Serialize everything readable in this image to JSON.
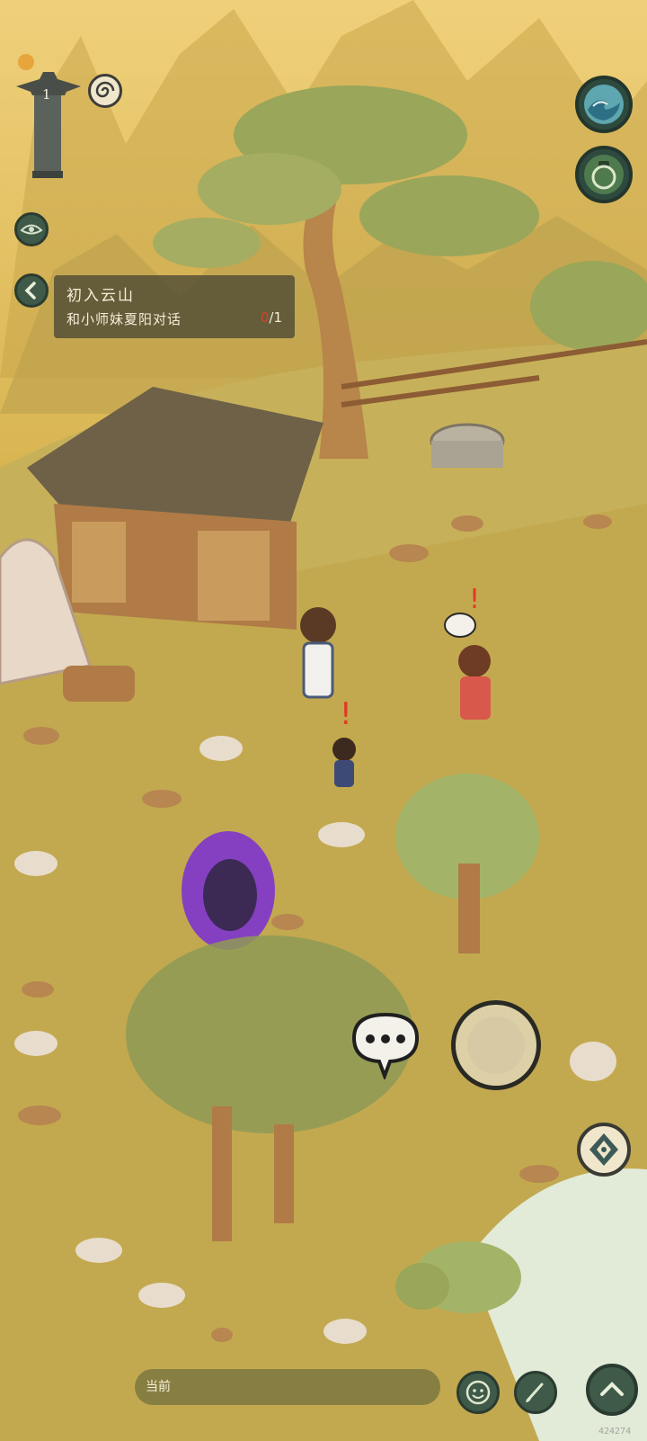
{
  "hud": {
    "level": "1"
  },
  "quest": {
    "title": "初入云山",
    "description": "和小师妹夏阳对话",
    "progress_current": "0",
    "progress_total": "/1"
  },
  "chat": {
    "channel_label": "当前"
  },
  "watermark": "424274",
  "colors": {
    "sky": "#e9c464",
    "ground": "#c8ad52",
    "button_dark": "#3f5a48",
    "button_teal": "#5fa7b0",
    "portal": "#9b3dff",
    "water": "#dfe8d8"
  },
  "icons": {
    "avatar_pillar": "stone-pillar-icon",
    "spiral": "spiral-icon",
    "wave": "wave-skill-icon",
    "jar": "jar-icon",
    "eye": "eye-icon",
    "back": "back-arrow-icon",
    "talk": "speech-bubble-icon",
    "joystick": "joystick-icon",
    "compass": "compass-icon",
    "emote": "smile-icon",
    "brush": "brush-icon",
    "up": "chevron-up-icon"
  }
}
